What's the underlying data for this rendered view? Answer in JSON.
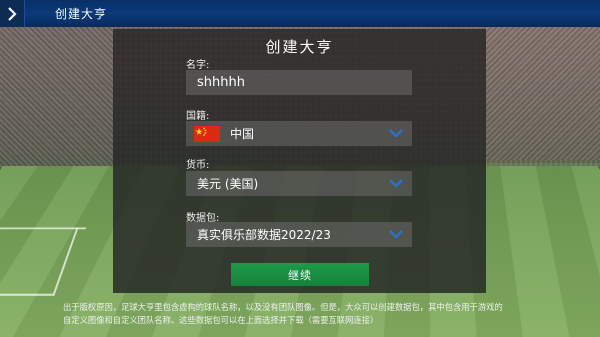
{
  "topbar": {
    "title": "创建大亨"
  },
  "dialog": {
    "title": "创建大亨",
    "name": {
      "label": "名字:",
      "value": "shhhhh"
    },
    "nationality": {
      "label": "国籍:",
      "value": "中国",
      "flag_color": "#de2910"
    },
    "currency": {
      "label": "货币:",
      "value": "美元 (美国)"
    },
    "data_pack": {
      "label": "数据包:",
      "value": "真实俱乐部数据2022/23"
    },
    "continue_label": "继续"
  },
  "footer": {
    "line1": "出于版权原因，足球大亨里包含虚构的球队名称，以及没有团队图像。但是，大众可以创建数据包，其中包含用于游戏的",
    "line2": "自定义图像和自定义团队名称。这些数据包可以在上面选择并下载（需要互联网连接）"
  },
  "colors": {
    "topbar": "#0b3a7c",
    "chevron": "#2a73c9",
    "continue_button": "#1f9a4a"
  }
}
